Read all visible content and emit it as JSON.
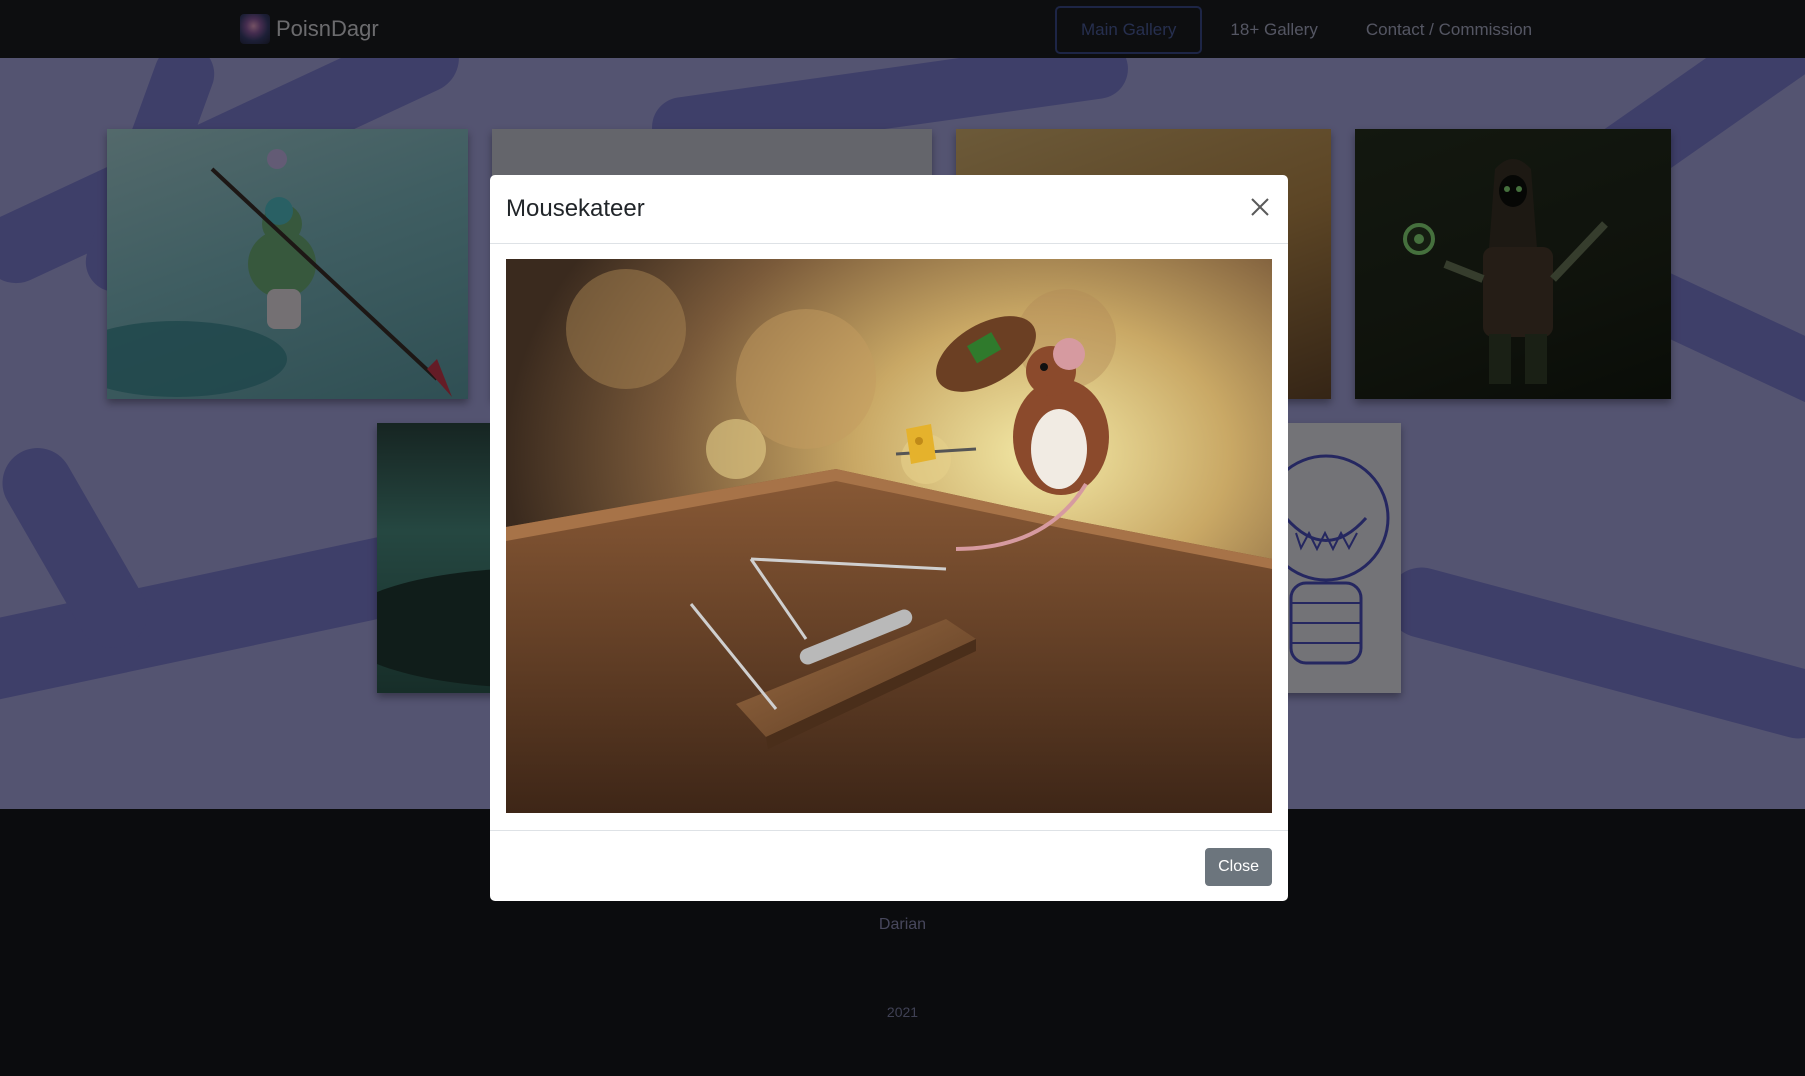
{
  "navbar": {
    "brand": "PoisnDagr",
    "links": [
      {
        "label": "Main Gallery",
        "active": true
      },
      {
        "label": "18+ Gallery",
        "active": false
      },
      {
        "label": "Contact / Commission",
        "active": false
      }
    ]
  },
  "footer": {
    "name": "Darian",
    "year": "2021"
  },
  "modal": {
    "title": "Mousekateer",
    "close_button": "Close"
  },
  "colors": {
    "navbar_bg": "#1b1c20",
    "gallery_bg": "#a9a8e3",
    "accent": "#3b4a8c",
    "close_button": "#6c757d"
  }
}
